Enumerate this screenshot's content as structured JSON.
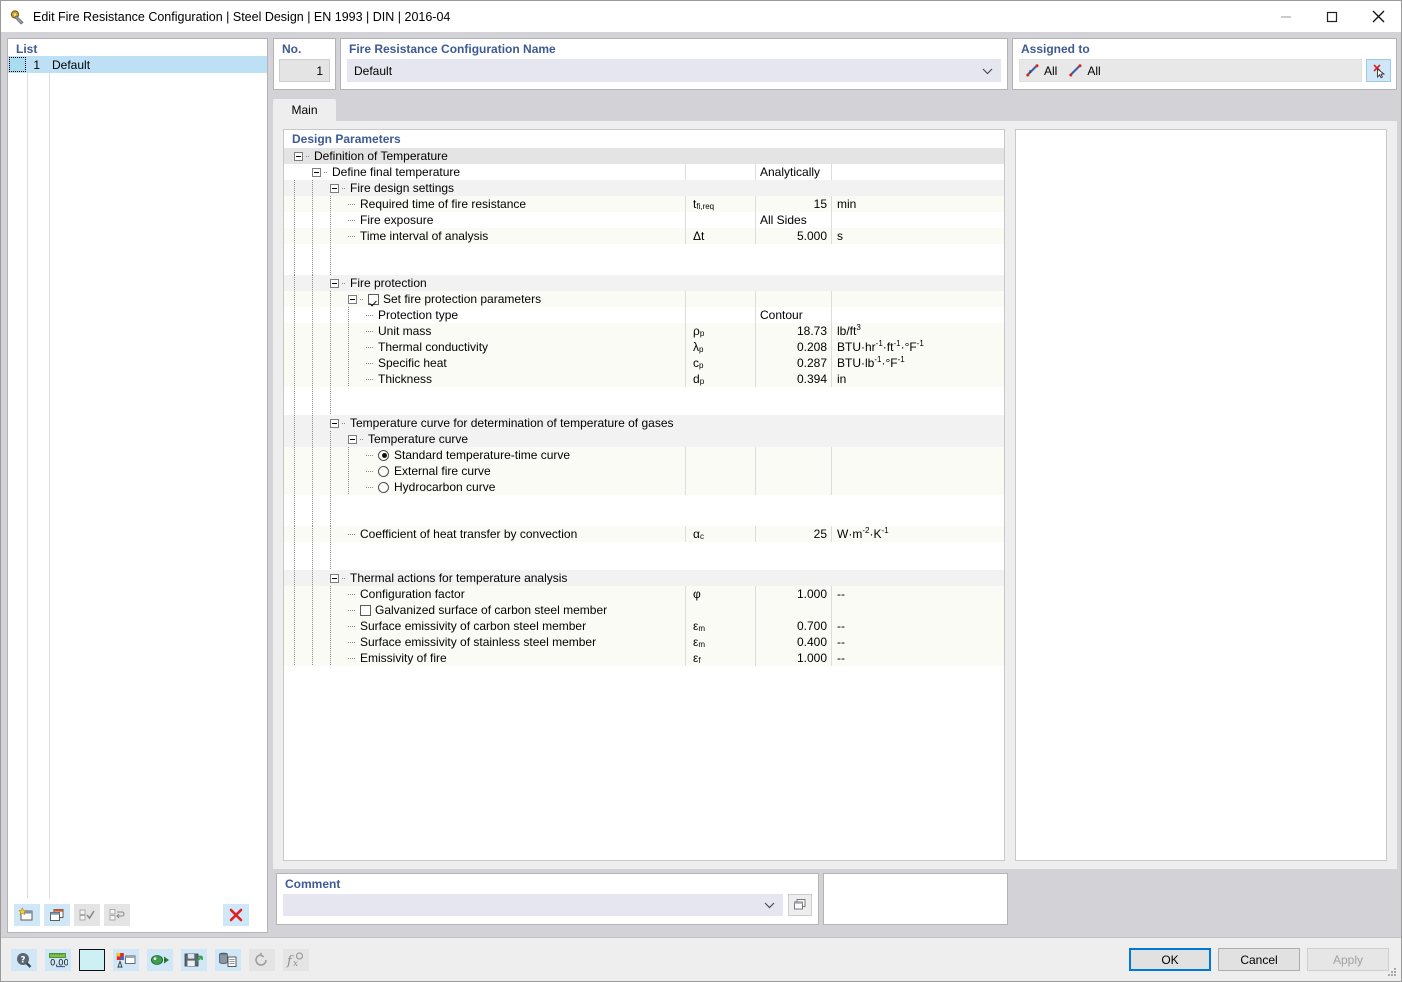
{
  "window": {
    "title": "Edit Fire Resistance Configuration | Steel Design | EN 1993 | DIN | 2016-04",
    "icon": "app-icon",
    "minimize": "minimize-icon",
    "maximize": "maximize-icon",
    "close": "close-icon"
  },
  "list": {
    "label": "List",
    "rows": [
      {
        "no": "1",
        "name": "Default"
      }
    ],
    "toolbar": [
      {
        "name": "new-item-button",
        "state": "enabled"
      },
      {
        "name": "copy-item-button",
        "state": "enabled"
      },
      {
        "name": "select-all-button",
        "state": "disabled"
      },
      {
        "name": "invert-selection-button",
        "state": "disabled"
      },
      {
        "name": "delete-item-button",
        "state": "enabled"
      }
    ]
  },
  "number": {
    "label": "No.",
    "value": "1"
  },
  "name": {
    "label": "Fire Resistance Configuration Name",
    "value": "Default"
  },
  "assigned": {
    "label": "Assigned to",
    "item1": "All",
    "item2": "All",
    "button": "select-objects-button"
  },
  "tabs": [
    {
      "label": "Main",
      "active": true
    }
  ],
  "design_parameters": {
    "label": "Design Parameters",
    "rows": [
      {
        "id": "r1",
        "level": 0,
        "glyph": "expander",
        "label": "Definition of Temperature",
        "sym": "",
        "val": "",
        "unit": "",
        "tint": "l0",
        "span": true
      },
      {
        "id": "r2",
        "level": 1,
        "glyph": "expander",
        "label": "Define final temperature",
        "sym": "",
        "val": "Analytically",
        "valAlign": "left",
        "unit": "",
        "tint": "l1"
      },
      {
        "id": "r3",
        "level": 2,
        "glyph": "expander",
        "label": "Fire design settings",
        "sym": "",
        "val": "",
        "unit": "",
        "tint": "l2",
        "span": true
      },
      {
        "id": "r4",
        "level": 3,
        "glyph": "leaf",
        "label": "Required time of fire resistance",
        "sym": "t<sub>fi,req</sub>",
        "val": "15",
        "unit": "min",
        "tint": "l3"
      },
      {
        "id": "r5",
        "level": 3,
        "glyph": "leaf",
        "label": "Fire exposure",
        "sym": "",
        "val": "All Sides",
        "valAlign": "left",
        "unit": "",
        "tint": "l1"
      },
      {
        "id": "r6",
        "level": 3,
        "glyph": "leaf",
        "label": "Time interval of analysis",
        "sym": "Δt",
        "val": "5.000",
        "unit": "s",
        "tint": "l3"
      },
      {
        "id": "g1",
        "level": 3,
        "glyph": "none",
        "label": "",
        "sym": "",
        "val": "",
        "unit": "",
        "tint": "gap",
        "nolines": true,
        "height": 16
      },
      {
        "id": "g2",
        "level": 3,
        "glyph": "none",
        "label": "",
        "sym": "",
        "val": "",
        "unit": "",
        "tint": "gap",
        "nolines": true,
        "height": 15
      },
      {
        "id": "r7",
        "level": 2,
        "glyph": "expander",
        "label": "Fire protection",
        "sym": "",
        "val": "",
        "unit": "",
        "tint": "l2",
        "span": true
      },
      {
        "id": "r8",
        "level": 3,
        "glyph": "expander-checkbox",
        "checked": true,
        "label": "Set fire protection parameters",
        "sym": "",
        "val": "",
        "unit": "",
        "tint": "l3"
      },
      {
        "id": "r9",
        "level": 4,
        "glyph": "leaf",
        "label": "Protection type",
        "sym": "",
        "val": "Contour",
        "valAlign": "left",
        "unit": "",
        "tint": "l1"
      },
      {
        "id": "r10",
        "level": 4,
        "glyph": "leaf",
        "label": "Unit mass",
        "sym": "ρ<sub>p</sub>",
        "val": "18.73",
        "unit": "lb/ft<sup>3</sup>",
        "tint": "l3"
      },
      {
        "id": "r11",
        "level": 4,
        "glyph": "leaf",
        "label": "Thermal conductivity",
        "sym": "λ<sub>p</sub>",
        "val": "0.208",
        "unit": "BTU·hr<sup>-1</sup>·ft<sup>-1</sup>·°F<sup>-1</sup>",
        "tint": "l3"
      },
      {
        "id": "r12",
        "level": 4,
        "glyph": "leaf",
        "label": "Specific heat",
        "sym": "c<sub>p</sub>",
        "val": "0.287",
        "unit": "BTU·lb<sup>-1</sup>·°F<sup>-1</sup>",
        "tint": "l3"
      },
      {
        "id": "r13",
        "level": 4,
        "glyph": "leaf",
        "label": "Thickness",
        "sym": "d<sub>p</sub>",
        "val": "0.394",
        "unit": "in",
        "tint": "l3"
      },
      {
        "id": "g3",
        "level": 3,
        "glyph": "none",
        "label": "",
        "sym": "",
        "val": "",
        "unit": "",
        "tint": "gap",
        "nolines": true,
        "height": 16
      },
      {
        "id": "g4",
        "level": 3,
        "glyph": "none",
        "label": "",
        "sym": "",
        "val": "",
        "unit": "",
        "tint": "gap",
        "nolines": true,
        "height": 12
      },
      {
        "id": "r14",
        "level": 2,
        "glyph": "expander",
        "label": "Temperature curve for determination of temperature of gases",
        "sym": "",
        "val": "",
        "unit": "",
        "tint": "l2",
        "span": true
      },
      {
        "id": "r15",
        "level": 3,
        "glyph": "expander",
        "label": "Temperature curve",
        "sym": "",
        "val": "",
        "unit": "",
        "tint": "l2",
        "span": true
      },
      {
        "id": "r16",
        "level": 4,
        "glyph": "radio",
        "checked": true,
        "label": "Standard temperature-time curve",
        "sym": "",
        "val": "",
        "unit": "",
        "tint": "l3"
      },
      {
        "id": "r17",
        "level": 4,
        "glyph": "radio",
        "checked": false,
        "label": "External fire curve",
        "sym": "",
        "val": "",
        "unit": "",
        "tint": "l3"
      },
      {
        "id": "r18",
        "level": 4,
        "glyph": "radio",
        "checked": false,
        "label": "Hydrocarbon curve",
        "sym": "",
        "val": "",
        "unit": "",
        "tint": "l3"
      },
      {
        "id": "g5",
        "level": 3,
        "glyph": "none",
        "label": "",
        "sym": "",
        "val": "",
        "unit": "",
        "tint": "gap",
        "nolines": true,
        "height": 16
      },
      {
        "id": "g6",
        "level": 3,
        "glyph": "none",
        "label": "",
        "sym": "",
        "val": "",
        "unit": "",
        "tint": "gap",
        "nolines": true,
        "height": 15
      },
      {
        "id": "r19",
        "level": 3,
        "glyph": "leaf",
        "label": "Coefficient of heat transfer by convection",
        "sym": "α<sub>c</sub>",
        "val": "25",
        "unit": "W·m<sup>-2</sup>·K<sup>-1</sup>",
        "tint": "l3"
      },
      {
        "id": "g7",
        "level": 3,
        "glyph": "none",
        "label": "",
        "sym": "",
        "val": "",
        "unit": "",
        "tint": "gap",
        "nolines": true,
        "height": 16
      },
      {
        "id": "g8",
        "level": 3,
        "glyph": "none",
        "label": "",
        "sym": "",
        "val": "",
        "unit": "",
        "tint": "gap",
        "nolines": true,
        "height": 12
      },
      {
        "id": "r20",
        "level": 2,
        "glyph": "expander",
        "label": "Thermal actions for temperature analysis",
        "sym": "",
        "val": "",
        "unit": "",
        "tint": "l2",
        "span": true
      },
      {
        "id": "r21",
        "level": 3,
        "glyph": "leaf",
        "label": "Configuration factor",
        "sym": "φ",
        "val": "1.000",
        "unit": "--",
        "tint": "l3"
      },
      {
        "id": "r22",
        "level": 3,
        "glyph": "checkbox",
        "checked": false,
        "label": "Galvanized surface of carbon steel member",
        "sym": "",
        "val": "",
        "unit": "",
        "tint": "l3"
      },
      {
        "id": "r23",
        "level": 3,
        "glyph": "leaf",
        "label": "Surface emissivity of carbon steel member",
        "sym": "ε<sub>m</sub>",
        "val": "0.700",
        "unit": "--",
        "tint": "l3"
      },
      {
        "id": "r24",
        "level": 3,
        "glyph": "leaf",
        "label": "Surface emissivity of stainless steel member",
        "sym": "ε<sub>m</sub>",
        "val": "0.400",
        "unit": "--",
        "tint": "l3"
      },
      {
        "id": "r25",
        "level": 3,
        "glyph": "leaf",
        "label": "Emissivity of fire",
        "sym": "ε<sub>f</sub>",
        "val": "1.000",
        "unit": "--",
        "tint": "l3"
      }
    ]
  },
  "comment": {
    "label": "Comment",
    "value": "",
    "button": "comment-picker-button"
  },
  "bottom_toolbar": [
    {
      "name": "help-button",
      "state": "enabled"
    },
    {
      "name": "units-button",
      "state": "enabled"
    },
    {
      "name": "color-button",
      "state": "enabled"
    },
    {
      "name": "settings-button",
      "state": "enabled"
    },
    {
      "name": "import-button",
      "state": "enabled"
    },
    {
      "name": "save-button",
      "state": "enabled"
    },
    {
      "name": "database-button",
      "state": "enabled"
    },
    {
      "name": "restore-button",
      "state": "disabled"
    },
    {
      "name": "formula-button",
      "state": "disabled"
    }
  ],
  "dialog_buttons": {
    "ok": "OK",
    "cancel": "Cancel",
    "apply": "Apply",
    "apply_disabled": true
  },
  "colors": {
    "accent": "#0078d7",
    "group_label": "#3d5a94",
    "selection": "#bde0f7",
    "toolbtn": "#cfe7f7",
    "delete_red": "#e02020"
  }
}
